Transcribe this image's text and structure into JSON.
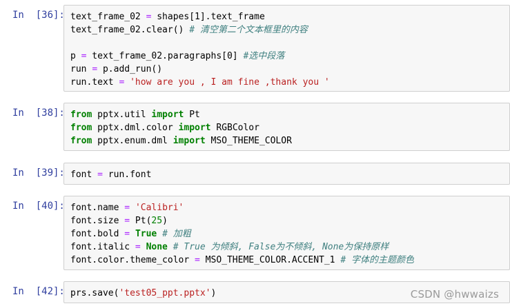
{
  "cells": [
    {
      "prompt": "In  [36]:",
      "lines": [
        [
          [
            "t",
            "text_frame_02 "
          ],
          [
            "op",
            "="
          ],
          [
            "t",
            " shapes[1].text_frame"
          ]
        ],
        [
          [
            "t",
            "text_frame_02.clear() "
          ],
          [
            "cm",
            "# 清空第二个文本框里的内容"
          ]
        ],
        [],
        [
          [
            "t",
            "p "
          ],
          [
            "op",
            "="
          ],
          [
            "t",
            " text_frame_02.paragraphs[0] "
          ],
          [
            "cm",
            "#选中段落"
          ]
        ],
        [
          [
            "t",
            "run "
          ],
          [
            "op",
            "="
          ],
          [
            "t",
            " p.add_run()"
          ]
        ],
        [
          [
            "t",
            "run.text "
          ],
          [
            "op",
            "="
          ],
          [
            "t",
            " "
          ],
          [
            "str",
            "'how are you , I am fine ,thank you '"
          ]
        ]
      ]
    },
    {
      "prompt": "In  [38]:",
      "lines": [
        [
          [
            "kw",
            "from"
          ],
          [
            "t",
            " pptx.util "
          ],
          [
            "kw",
            "import"
          ],
          [
            "t",
            " Pt"
          ]
        ],
        [
          [
            "kw",
            "from"
          ],
          [
            "t",
            " pptx.dml.color "
          ],
          [
            "kw",
            "import"
          ],
          [
            "t",
            " RGBColor"
          ]
        ],
        [
          [
            "kw",
            "from"
          ],
          [
            "t",
            " pptx.enum.dml "
          ],
          [
            "kw",
            "import"
          ],
          [
            "t",
            " MSO_THEME_COLOR"
          ]
        ]
      ]
    },
    {
      "prompt": "In  [39]:",
      "lines": [
        [
          [
            "t",
            "font "
          ],
          [
            "op",
            "="
          ],
          [
            "t",
            " run.font"
          ]
        ]
      ]
    },
    {
      "prompt": "In  [40]:",
      "lines": [
        [
          [
            "t",
            "font.name "
          ],
          [
            "op",
            "="
          ],
          [
            "t",
            " "
          ],
          [
            "str",
            "'Calibri'"
          ]
        ],
        [
          [
            "t",
            "font.size "
          ],
          [
            "op",
            "="
          ],
          [
            "t",
            " Pt("
          ],
          [
            "num",
            "25"
          ],
          [
            "t",
            ")"
          ]
        ],
        [
          [
            "t",
            "font.bold "
          ],
          [
            "op",
            "="
          ],
          [
            "t",
            " "
          ],
          [
            "kw",
            "True"
          ],
          [
            "t",
            " "
          ],
          [
            "cm",
            "# 加粗"
          ]
        ],
        [
          [
            "t",
            "font.italic "
          ],
          [
            "op",
            "="
          ],
          [
            "t",
            " "
          ],
          [
            "kw",
            "None"
          ],
          [
            "t",
            " "
          ],
          [
            "cm",
            "# True 为倾斜, False为不倾斜, None为保持原样"
          ]
        ],
        [
          [
            "t",
            "font.color.theme_color "
          ],
          [
            "op",
            "="
          ],
          [
            "t",
            " MSO_THEME_COLOR.ACCENT_1 "
          ],
          [
            "cm",
            "# 字体的主题颜色"
          ]
        ]
      ]
    },
    {
      "prompt": "In  [42]:",
      "lines": [
        [
          [
            "t",
            "prs.save("
          ],
          [
            "str",
            "'test05_ppt.pptx'"
          ],
          [
            "t",
            ")"
          ]
        ]
      ]
    }
  ],
  "watermark": "CSDN @hwwaizs"
}
